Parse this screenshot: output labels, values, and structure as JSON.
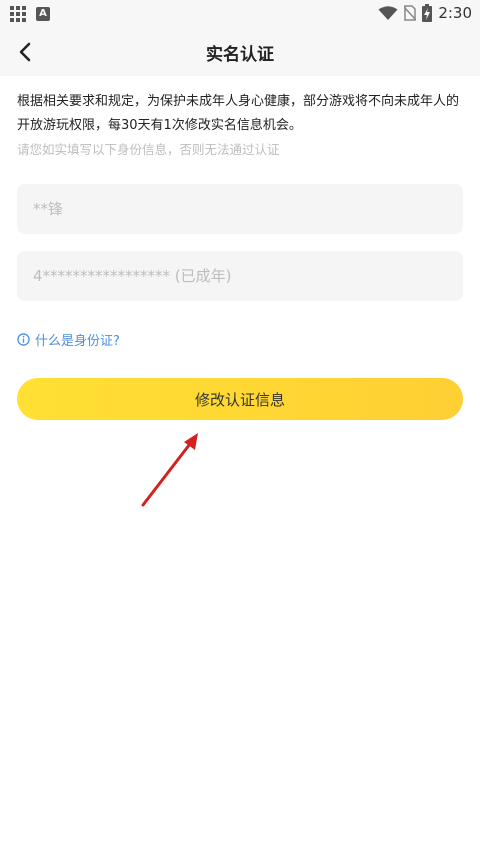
{
  "status_bar": {
    "time": "2:30",
    "icons": [
      "app-grid-icon",
      "accessibility-a-icon",
      "wifi-icon",
      "no-sim-icon",
      "battery-charging-icon"
    ],
    "a_label": "A"
  },
  "header": {
    "title": "实名认证"
  },
  "notice": {
    "text": "根据相关要求和规定，为保护未成年人身心健康，部分游戏将不向未成年人的开放游玩权限，每30天有1次修改实名信息机会。",
    "hint": "请您如实填写以下身份信息，否则无法通过认证"
  },
  "form": {
    "name_value": "**锋",
    "id_value": "4***************** (已成年)"
  },
  "help": {
    "label": "什么是身份证?"
  },
  "submit": {
    "label": "修改认证信息"
  },
  "colors": {
    "accent_yellow": "#ffd633",
    "link_blue": "#4a90e2",
    "annotation_red": "#d42020"
  }
}
